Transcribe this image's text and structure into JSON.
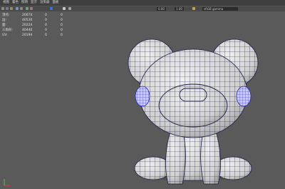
{
  "menubar": {
    "items": [
      "视图",
      "着色",
      "照明",
      "显示",
      "渲染器",
      "面板"
    ]
  },
  "toolbar": {
    "value_a": "0.00",
    "value_b": "1.00",
    "color_space": "sRGB gamma"
  },
  "hud": {
    "rows": [
      {
        "label": "顶点:",
        "c1": "20674",
        "c2": "0",
        "c3": "0"
      },
      {
        "label": "边:",
        "c1": "40530",
        "c2": "0",
        "c3": "0"
      },
      {
        "label": "面:",
        "c1": "20224",
        "c2": "0",
        "c3": "0"
      },
      {
        "label": "三角形:",
        "c1": "40440",
        "c2": "0",
        "c3": "0"
      },
      {
        "label": "UV:",
        "c1": "20194",
        "c2": "0",
        "c3": "0"
      }
    ]
  },
  "colors": {
    "viewport_bg": "#5a5a5a",
    "mesh_fill": "#d7d7d7",
    "wire": "#1c1c44",
    "eye_wire": "#2a2ab5",
    "axis_x": "#d23c3c",
    "axis_y": "#3cc03c"
  },
  "icons": [
    "select-icon",
    "lasso-icon",
    "paint-icon",
    "move-icon",
    "camera-icon",
    "grid-icon",
    "wireframe-icon",
    "shading-icon",
    "light-icon",
    "shadow-icon",
    "color-swatch-icon"
  ]
}
